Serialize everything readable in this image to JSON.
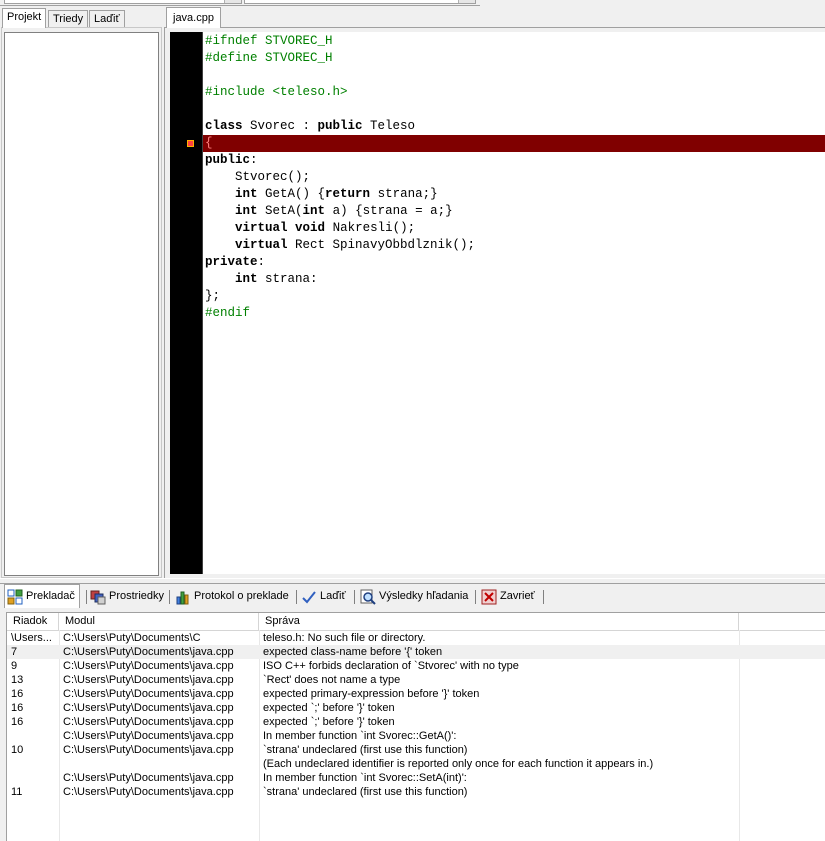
{
  "left_tabs": [
    {
      "label": "Projekt",
      "active": true
    },
    {
      "label": "Triedy",
      "active": false
    },
    {
      "label": "Laďiť",
      "active": false
    }
  ],
  "editor": {
    "tab_label": "java.cpp",
    "error_line": 7,
    "lines": [
      [
        {
          "t": "pp",
          "s": "#ifndef STVOREC_H"
        }
      ],
      [
        {
          "t": "pp",
          "s": "#define STVOREC_H"
        }
      ],
      [],
      [
        {
          "t": "pp",
          "s": "#include <teleso.h>"
        }
      ],
      [],
      [
        {
          "t": "kw",
          "s": "class"
        },
        {
          "t": "txt",
          "s": " Svorec : "
        },
        {
          "t": "kw",
          "s": "public"
        },
        {
          "t": "txt",
          "s": " Teleso"
        }
      ],
      [
        {
          "t": "err",
          "s": "{"
        }
      ],
      [
        {
          "t": "kw",
          "s": "public"
        },
        {
          "t": "txt",
          "s": ":"
        }
      ],
      [
        {
          "t": "txt",
          "s": "    Stvorec();"
        }
      ],
      [
        {
          "t": "txt",
          "s": "    "
        },
        {
          "t": "kw",
          "s": "int"
        },
        {
          "t": "txt",
          "s": " GetA() {"
        },
        {
          "t": "kw",
          "s": "return"
        },
        {
          "t": "txt",
          "s": " strana;}"
        }
      ],
      [
        {
          "t": "txt",
          "s": "    "
        },
        {
          "t": "kw",
          "s": "int"
        },
        {
          "t": "txt",
          "s": " SetA("
        },
        {
          "t": "kw",
          "s": "int"
        },
        {
          "t": "txt",
          "s": " a) {strana = a;}"
        }
      ],
      [
        {
          "t": "txt",
          "s": "    "
        },
        {
          "t": "kw",
          "s": "virtual"
        },
        {
          "t": "txt",
          "s": " "
        },
        {
          "t": "kw",
          "s": "void"
        },
        {
          "t": "txt",
          "s": " Nakresli();"
        }
      ],
      [
        {
          "t": "txt",
          "s": "    "
        },
        {
          "t": "kw",
          "s": "virtual"
        },
        {
          "t": "txt",
          "s": " Rect SpinavyObbdlznik();"
        }
      ],
      [
        {
          "t": "kw",
          "s": "private"
        },
        {
          "t": "txt",
          "s": ":"
        }
      ],
      [
        {
          "t": "txt",
          "s": "    "
        },
        {
          "t": "kw",
          "s": "int"
        },
        {
          "t": "txt",
          "s": " strana:"
        }
      ],
      [
        {
          "t": "txt",
          "s": "};"
        }
      ],
      [
        {
          "t": "pp",
          "s": "#endif"
        }
      ]
    ]
  },
  "bottom_tabs": [
    {
      "label": "Prekladač",
      "icon": "compiler-icon",
      "active": true
    },
    {
      "label": "Prostriedky",
      "icon": "resources-icon",
      "active": false
    },
    {
      "label": "Protokol o preklade",
      "icon": "compile-log-icon",
      "active": false
    },
    {
      "label": "Laďiť",
      "icon": "debug-check-icon",
      "active": false
    },
    {
      "label": "Výsledky hľadania",
      "icon": "find-results-icon",
      "active": false
    },
    {
      "label": "Zavrieť",
      "icon": "close-tab-icon",
      "active": false
    }
  ],
  "compiler_list": {
    "columns": [
      "Riadok",
      "Modul",
      "Správa"
    ],
    "rows": [
      [
        "\\Users...",
        "C:\\Users\\Puty\\Documents\\C",
        "teleso.h: No such file or directory."
      ],
      [
        "7",
        "C:\\Users\\Puty\\Documents\\java.cpp",
        "expected class-name before '{' token"
      ],
      [
        "9",
        "C:\\Users\\Puty\\Documents\\java.cpp",
        "ISO C++ forbids declaration of `Stvorec' with no type"
      ],
      [
        "13",
        "C:\\Users\\Puty\\Documents\\java.cpp",
        "`Rect' does not name a type"
      ],
      [
        "16",
        "C:\\Users\\Puty\\Documents\\java.cpp",
        "expected primary-expression before '}' token"
      ],
      [
        "16",
        "C:\\Users\\Puty\\Documents\\java.cpp",
        "expected `;' before '}' token"
      ],
      [
        "16",
        "C:\\Users\\Puty\\Documents\\java.cpp",
        "expected `;' before '}' token"
      ],
      [
        "",
        "C:\\Users\\Puty\\Documents\\java.cpp",
        "In member function `int Svorec::GetA()':"
      ],
      [
        "10",
        "C:\\Users\\Puty\\Documents\\java.cpp",
        "`strana' undeclared (first use this function)"
      ],
      [
        "",
        "",
        "(Each undeclared identifier is reported only once for each function it appears in.)"
      ],
      [
        "",
        "C:\\Users\\Puty\\Documents\\java.cpp",
        "In member function `int Svorec::SetA(int)':"
      ],
      [
        "11",
        "C:\\Users\\Puty\\Documents\\java.cpp",
        "`strana' undeclared (first use this function)"
      ]
    ],
    "selected_row": 1
  }
}
